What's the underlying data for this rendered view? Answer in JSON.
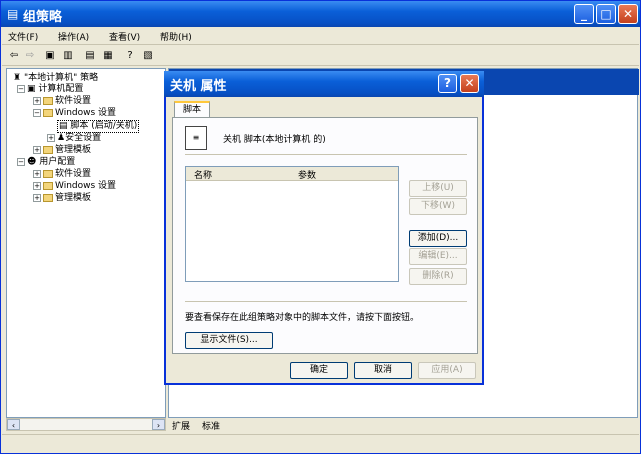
{
  "window": {
    "title": "组策略"
  },
  "menu": [
    "文件(F)",
    "操作(A)",
    "查看(V)",
    "帮助(H)"
  ],
  "tree": {
    "root": "\"本地计算机\" 策略",
    "computer": "计算机配置",
    "software": "软件设置",
    "windows": "Windows 设置",
    "scripts": "脚本 (启动/关机)",
    "security": "安全设置",
    "admin": "管理模板",
    "user": "用户配置",
    "u_software": "软件设置",
    "u_windows": "Windows 设置",
    "u_admin": "管理模板"
  },
  "tabs": {
    "extended": "扩展",
    "standard": "标准"
  },
  "dialog": {
    "title": "关机 属性",
    "tab": "脚本",
    "description": "关机 脚本(本地计算机 的)",
    "columns": {
      "name": "名称",
      "params": "参数"
    },
    "buttons": {
      "up": "上移(U)",
      "down": "下移(W)",
      "add": "添加(D)...",
      "edit": "编辑(E)...",
      "remove": "删除(R)",
      "show_files": "显示文件(S)...",
      "ok": "确定",
      "cancel": "取消",
      "apply": "应用(A)"
    },
    "note": "要查看保存在此组策略对象中的脚本文件，请按下面按钮。"
  }
}
